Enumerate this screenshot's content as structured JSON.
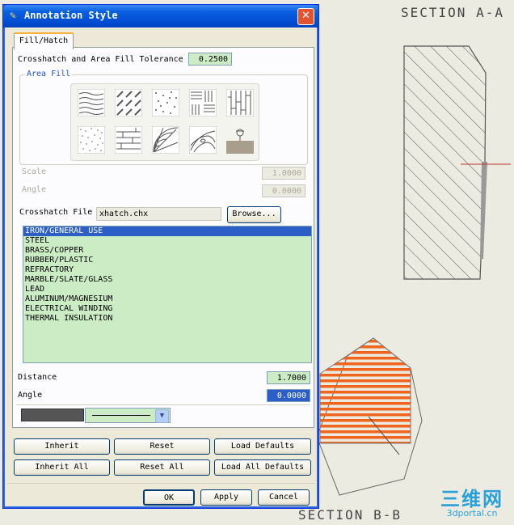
{
  "window": {
    "title": "Annotation Style",
    "close": "✕"
  },
  "background": {
    "section_a": "SECTION A-A",
    "section_b": "SECTION B-B",
    "watermark_line1": "三维网",
    "watermark_line2": "3dportal.cn"
  },
  "tab": {
    "label": "Fill/Hatch"
  },
  "tolerance": {
    "label": "Crosshatch and Area Fill Tolerance",
    "value": "0.2500"
  },
  "area_fill": {
    "title": "Area Fill",
    "patterns": [
      "wavy-lines-pattern",
      "diagonal-dashes-pattern",
      "dots-pattern",
      "basketweave-pattern",
      "vertical-bricks-pattern",
      "stipple-pattern",
      "horizontal-bricks-pattern",
      "radial-wood-pattern",
      "wood-grain-pattern",
      "solid-fill-pattern"
    ],
    "scale_label": "Scale",
    "scale_value": "1.0000",
    "angle_label": "Angle",
    "angle_value": "0.0000"
  },
  "crosshatch": {
    "label": "Crosshatch File",
    "file": "xhatch.chx",
    "browse": "Browse..."
  },
  "materials": [
    "IRON/GENERAL USE",
    "STEEL",
    "BRASS/COPPER",
    "RUBBER/PLASTIC",
    "REFRACTORY",
    "MARBLE/SLATE/GLASS",
    "LEAD",
    "ALUMINUM/MAGNESIUM",
    "ELECTRICAL WINDING",
    "THERMAL INSULATION"
  ],
  "selected_material": "IRON/GENERAL USE",
  "distance": {
    "label": "Distance",
    "value": "1.7000"
  },
  "angle": {
    "label": "Angle",
    "value": "0.0000"
  },
  "buttons": {
    "inherit": "Inherit",
    "reset": "Reset",
    "load_defaults": "Load Defaults",
    "inherit_all": "Inherit All",
    "reset_all": "Reset All",
    "load_all_defaults": "Load All Defaults",
    "ok": "OK",
    "apply": "Apply",
    "cancel": "Cancel"
  },
  "colors": {
    "hatch_orange": "#f0641e",
    "list_green": "#ccecc6",
    "selection_blue": "#2c5ec8"
  }
}
